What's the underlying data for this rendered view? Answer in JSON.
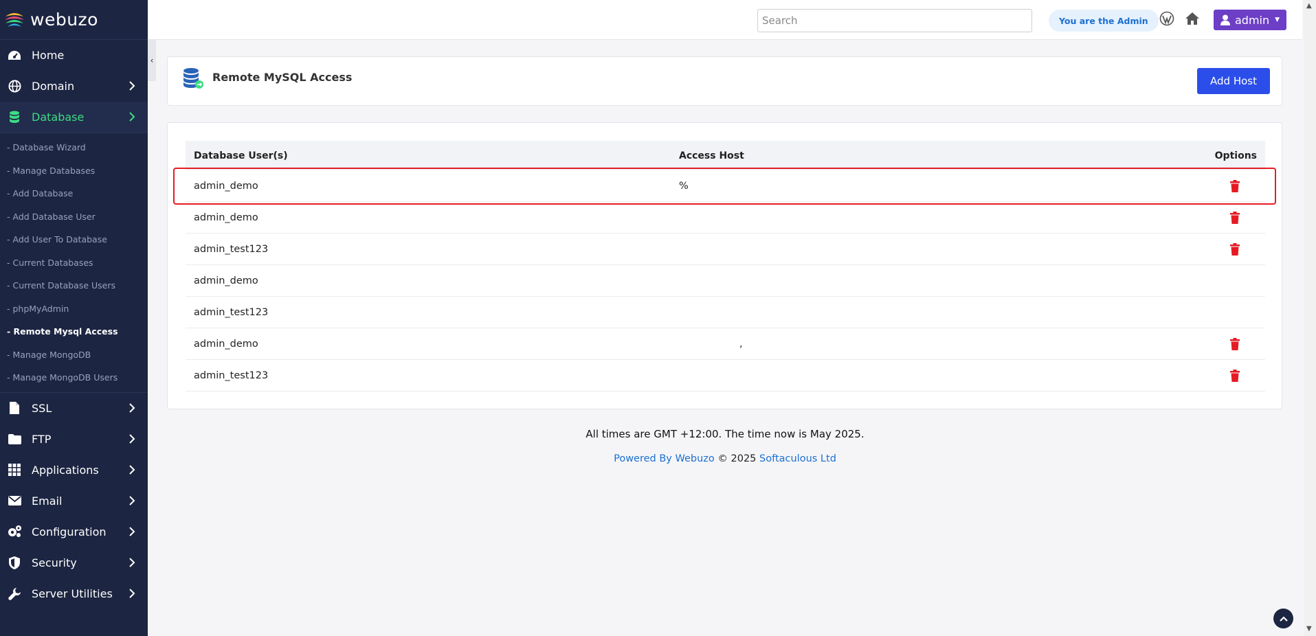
{
  "brand": {
    "name": "webuzo"
  },
  "sidebar": {
    "top_items": [
      {
        "label": "Home",
        "icon": "dashboard-icon"
      },
      {
        "label": "Domain",
        "icon": "globe-icon"
      },
      {
        "label": "Database",
        "icon": "database-icon"
      }
    ],
    "database_submenu": [
      "- Database Wizard",
      "- Manage Databases",
      "- Add Database",
      "- Add Database User",
      "- Add User To Database",
      "- Current Databases",
      "- Current Database Users",
      "- phpMyAdmin",
      "- Remote Mysql Access",
      "- Manage MongoDB",
      "- Manage MongoDB Users"
    ],
    "bottom_items": [
      {
        "label": "SSL",
        "icon": "file-icon"
      },
      {
        "label": "FTP",
        "icon": "folder-icon"
      },
      {
        "label": "Applications",
        "icon": "grid-icon"
      },
      {
        "label": "Email",
        "icon": "envelope-icon"
      },
      {
        "label": "Configuration",
        "icon": "gears-icon"
      },
      {
        "label": "Security",
        "icon": "shield-icon"
      },
      {
        "label": "Server Utilities",
        "icon": "wrench-icon"
      }
    ],
    "active_color": "#3ddc84",
    "bg_color": "#1c2541"
  },
  "topbar": {
    "search_placeholder": "Search",
    "admin_badge": "You are the Admin",
    "user_label": "admin"
  },
  "page": {
    "title": "Remote MySQL Access",
    "add_host_label": "Add Host"
  },
  "table": {
    "headers": {
      "user": "Database User(s)",
      "host": "Access Host",
      "options": "Options"
    },
    "rows": [
      {
        "user": "admin_demo",
        "host": "%",
        "deletable": true
      },
      {
        "user": "admin_demo",
        "host": "",
        "deletable": true
      },
      {
        "user": "admin_test123",
        "host": "",
        "deletable": true
      },
      {
        "user": "admin_demo",
        "host": "",
        "deletable": false
      },
      {
        "user": "admin_test123",
        "host": "",
        "deletable": false
      },
      {
        "user": "admin_demo",
        "host": ",",
        "deletable": true
      },
      {
        "user": "admin_test123",
        "host": "",
        "deletable": true
      }
    ]
  },
  "footer": {
    "time_text": "All times are GMT +12:00. The time now is May 2025.",
    "powered_link": "Powered By Webuzo",
    "copyright": " © 2025 ",
    "company_link": "Softaculous Ltd"
  },
  "colors": {
    "primary_button": "#2b4eea",
    "user_button": "#6c3fc6",
    "delete_icon": "#e51b23",
    "highlight_border": "#e51b23"
  }
}
